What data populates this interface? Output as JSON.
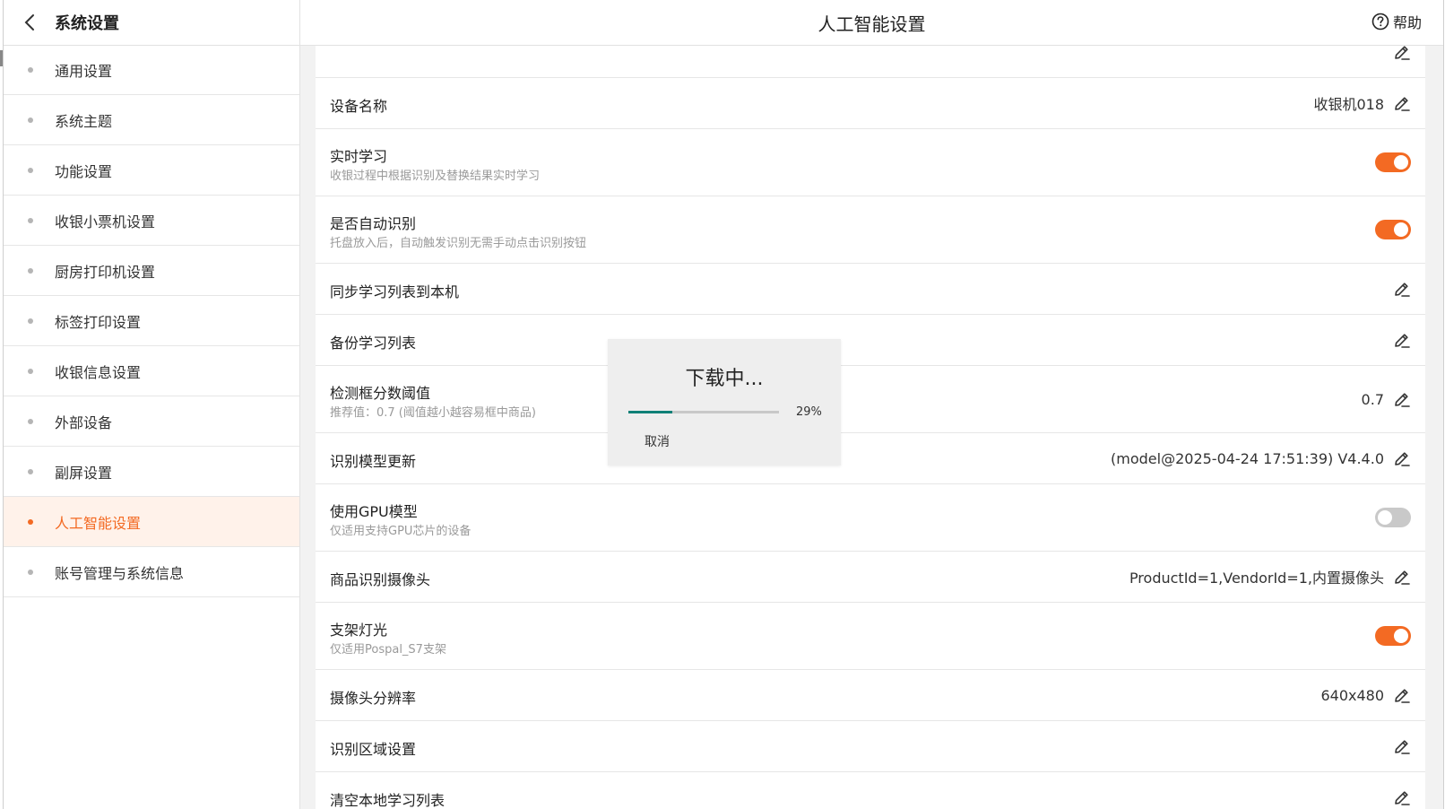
{
  "header": {
    "sidebar_title": "系统设置",
    "page_title": "人工智能设置",
    "help_label": "帮助"
  },
  "sidebar": {
    "items": [
      {
        "label": "通用设置",
        "active": false
      },
      {
        "label": "系统主题",
        "active": false
      },
      {
        "label": "功能设置",
        "active": false
      },
      {
        "label": "收银小票机设置",
        "active": false
      },
      {
        "label": "厨房打印机设置",
        "active": false
      },
      {
        "label": "标签打印设置",
        "active": false
      },
      {
        "label": "收银信息设置",
        "active": false
      },
      {
        "label": "外部设备",
        "active": false
      },
      {
        "label": "副屏设置",
        "active": false
      },
      {
        "label": "人工智能设置",
        "active": true
      },
      {
        "label": "账号管理与系统信息",
        "active": false
      }
    ]
  },
  "settings": {
    "rows": [
      {
        "title": "",
        "subtitle": "",
        "value": "",
        "control": "edit"
      },
      {
        "title": "设备名称",
        "subtitle": "",
        "value": "收银机018",
        "control": "edit"
      },
      {
        "title": "实时学习",
        "subtitle": "收银过程中根据识别及替换结果实时学习",
        "value": "",
        "control": "toggle",
        "on": true
      },
      {
        "title": "是否自动识别",
        "subtitle": "托盘放入后，自动触发识别无需手动点击识别按钮",
        "value": "",
        "control": "toggle",
        "on": true
      },
      {
        "title": "同步学习列表到本机",
        "subtitle": "",
        "value": "",
        "control": "edit"
      },
      {
        "title": "备份学习列表",
        "subtitle": "",
        "value": "",
        "control": "edit"
      },
      {
        "title": "检测框分数阈值",
        "subtitle": "推荐值：0.7 (阈值越小越容易框中商品)",
        "value": "0.7",
        "control": "edit"
      },
      {
        "title": "识别模型更新",
        "subtitle": "",
        "value": "(model@2025-04-24 17:51:39) V4.4.0",
        "control": "edit"
      },
      {
        "title": "使用GPU模型",
        "subtitle": "仅适用支持GPU芯片的设备",
        "value": "",
        "control": "toggle",
        "on": false
      },
      {
        "title": "商品识别摄像头",
        "subtitle": "",
        "value": "ProductId=1,VendorId=1,内置摄像头",
        "control": "edit"
      },
      {
        "title": "支架灯光",
        "subtitle": "仅适用Pospal_S7支架",
        "value": "",
        "control": "toggle",
        "on": true
      },
      {
        "title": "摄像头分辨率",
        "subtitle": "",
        "value": "640x480",
        "control": "edit"
      },
      {
        "title": "识别区域设置",
        "subtitle": "",
        "value": "",
        "control": "edit"
      },
      {
        "title": "清空本地学习列表",
        "subtitle": "",
        "value": "",
        "control": "edit"
      }
    ]
  },
  "dialog": {
    "title": "下载中...",
    "progress_percent": 29,
    "progress_label": "29%",
    "cancel_label": "取消"
  },
  "icons": {
    "back": "chevron-left-icon",
    "help": "question-circle-icon",
    "edit": "pencil-icon"
  },
  "colors": {
    "accent": "#f36a23",
    "active_bg": "#fff2ea",
    "progress": "#0f8077",
    "toggle_off": "#c9c9c9"
  }
}
